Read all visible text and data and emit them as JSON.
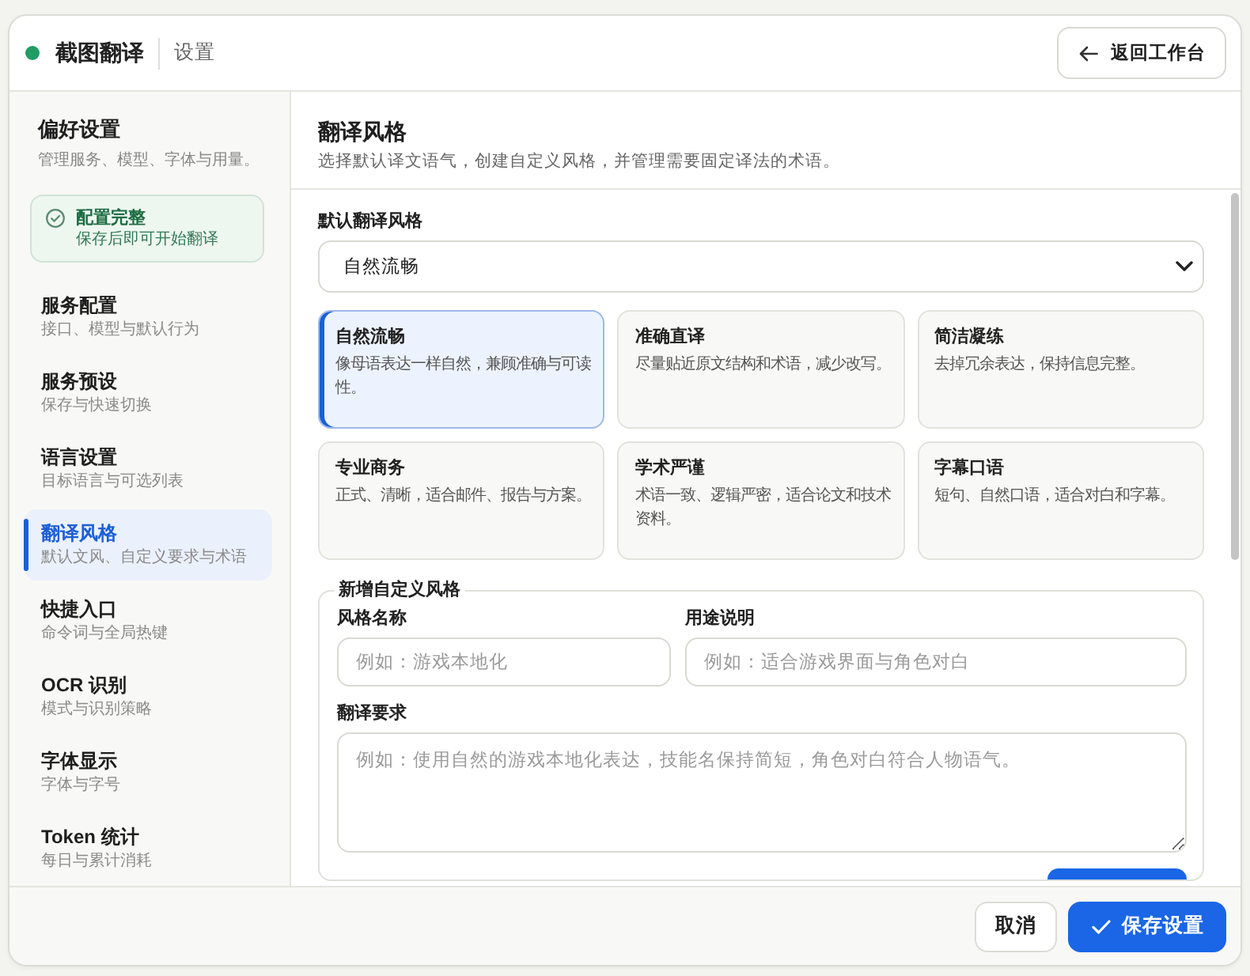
{
  "app": {
    "title": "截图翻译",
    "section": "设置",
    "back_button": "返回工作台"
  },
  "sidebar": {
    "title": "偏好设置",
    "subtitle": "管理服务、模型、字体与用量。",
    "status": {
      "title": "配置完整",
      "detail": "保存后即可开始翻译"
    },
    "items": [
      {
        "label": "服务配置",
        "detail": "接口、模型与默认行为",
        "selected": false
      },
      {
        "label": "服务预设",
        "detail": "保存与快速切换",
        "selected": false
      },
      {
        "label": "语言设置",
        "detail": "目标语言与可选列表",
        "selected": false
      },
      {
        "label": "翻译风格",
        "detail": "默认文风、自定义要求与术语",
        "selected": true
      },
      {
        "label": "快捷入口",
        "detail": "命令词与全局热键",
        "selected": false
      },
      {
        "label": "OCR 识别",
        "detail": "模式与识别策略",
        "selected": false
      },
      {
        "label": "字体显示",
        "detail": "字体与字号",
        "selected": false
      },
      {
        "label": "Token 统计",
        "detail": "每日与累计消耗",
        "selected": false
      }
    ]
  },
  "panel": {
    "title": "翻译风格",
    "subtitle": "选择默认译文语气，创建自定义风格，并管理需要固定译法的术语。",
    "default_style": {
      "label": "默认翻译风格",
      "value": "自然流畅"
    },
    "style_cards": [
      {
        "title": "自然流畅",
        "description": "像母语表达一样自然，兼顾准确与可读性。",
        "selected": true
      },
      {
        "title": "准确直译",
        "description": "尽量贴近原文结构和术语，减少改写。",
        "selected": false
      },
      {
        "title": "简洁凝练",
        "description": "去掉冗余表达，保持信息完整。",
        "selected": false
      },
      {
        "title": "专业商务",
        "description": "正式、清晰，适合邮件、报告与方案。",
        "selected": false
      },
      {
        "title": "学术严谨",
        "description": "术语一致、逻辑严密，适合论文和技术资料。",
        "selected": false
      },
      {
        "title": "字幕口语",
        "description": "短句、自然口语，适合对白和字幕。",
        "selected": false
      }
    ],
    "custom_style": {
      "legend": "新增自定义风格",
      "fields": [
        {
          "kind": "input",
          "label": "风格名称",
          "placeholder": "例如：游戏本地化"
        },
        {
          "kind": "input",
          "label": "用途说明",
          "placeholder": "例如：适合游戏界面与角色对白"
        },
        {
          "kind": "textarea",
          "label": "翻译要求",
          "placeholder": "例如：使用自然的游戏本地化表达，技能名保持简短，角色对白符合人物语气。"
        }
      ]
    }
  },
  "footer": {
    "buttons": [
      {
        "kind": "secondary",
        "label": "取消"
      },
      {
        "kind": "primary",
        "label": "保存设置"
      }
    ]
  }
}
